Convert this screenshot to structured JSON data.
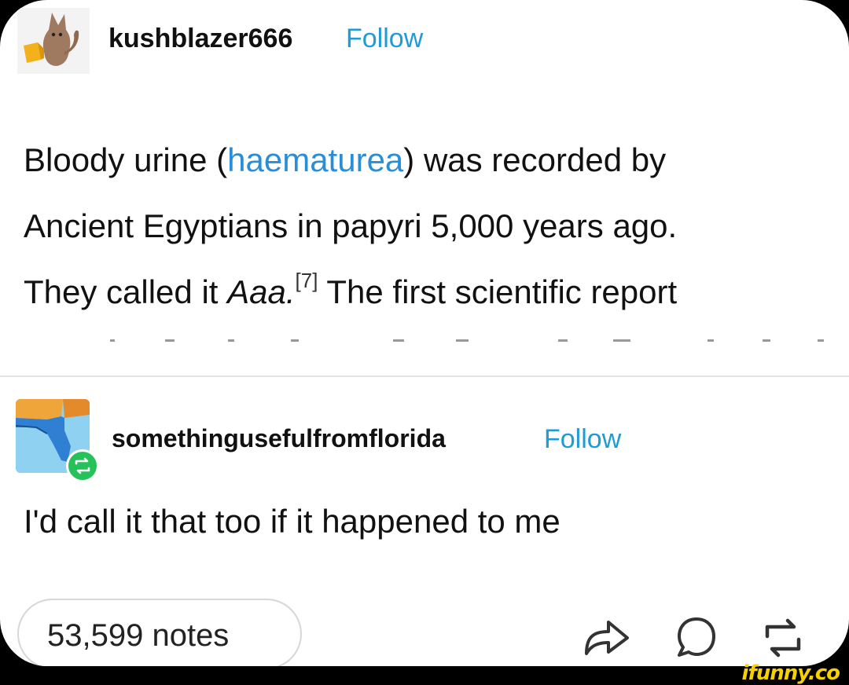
{
  "post": {
    "author": "kushblazer666",
    "follow_label": "Follow",
    "text_line1_a": "Bloody urine (",
    "text_link": "haematurea",
    "text_line1_b": ") was recorded by",
    "text_line2": "Ancient Egyptians in papyri 5,000 years ago.",
    "text_line3_a": "They called it ",
    "text_italic": "Aaa.",
    "citation": "[7]",
    "text_line3_b": " The first scientific report"
  },
  "reblog": {
    "author": "somethingusefulfromflorida",
    "follow_label": "Follow",
    "text": "I'd call it that too if it happened to me"
  },
  "footer": {
    "notes_label": "53,599 notes",
    "icons": [
      "share-icon",
      "reply-icon",
      "reblog-icon"
    ]
  },
  "watermark": "ifunny.co",
  "colors": {
    "follow": "#1f9bd6",
    "link": "#2a8dd8",
    "watermark": "#f7d000"
  }
}
